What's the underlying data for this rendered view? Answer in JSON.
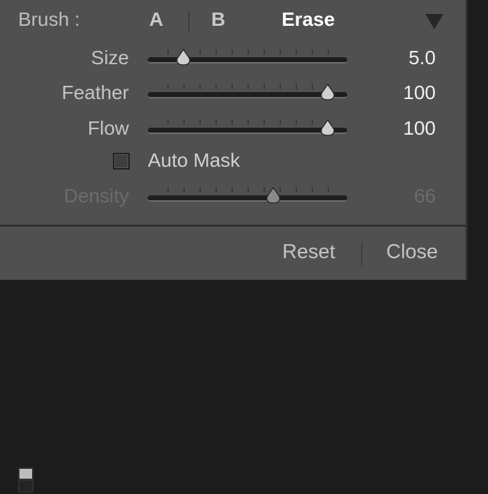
{
  "brush": {
    "label": "Brush :",
    "tabs": [
      {
        "label": "A",
        "selected": false
      },
      {
        "label": "B",
        "selected": false
      },
      {
        "label": "Erase",
        "selected": true
      }
    ]
  },
  "sliders": [
    {
      "label": "Size",
      "value": "5.0",
      "level": 0.1,
      "enabled": true
    },
    {
      "label": "Feather",
      "value": "100",
      "level": 1.0,
      "enabled": true
    },
    {
      "label": "Flow",
      "value": "100",
      "level": 1.0,
      "enabled": true
    },
    {
      "label": "Density",
      "value": "66",
      "level": 0.66,
      "enabled": false
    }
  ],
  "auto_mask": {
    "label": "Auto Mask",
    "checked": false
  },
  "footer": {
    "reset_label": "Reset",
    "close_label": "Close"
  },
  "icons": {
    "collapse": "triangle-down-icon",
    "panel_toggle": "panel-toggle-icon"
  },
  "colors": {
    "panel_bg": "#505050",
    "active_text": "#ffffff",
    "disabled_text": "#6c6c6c"
  }
}
